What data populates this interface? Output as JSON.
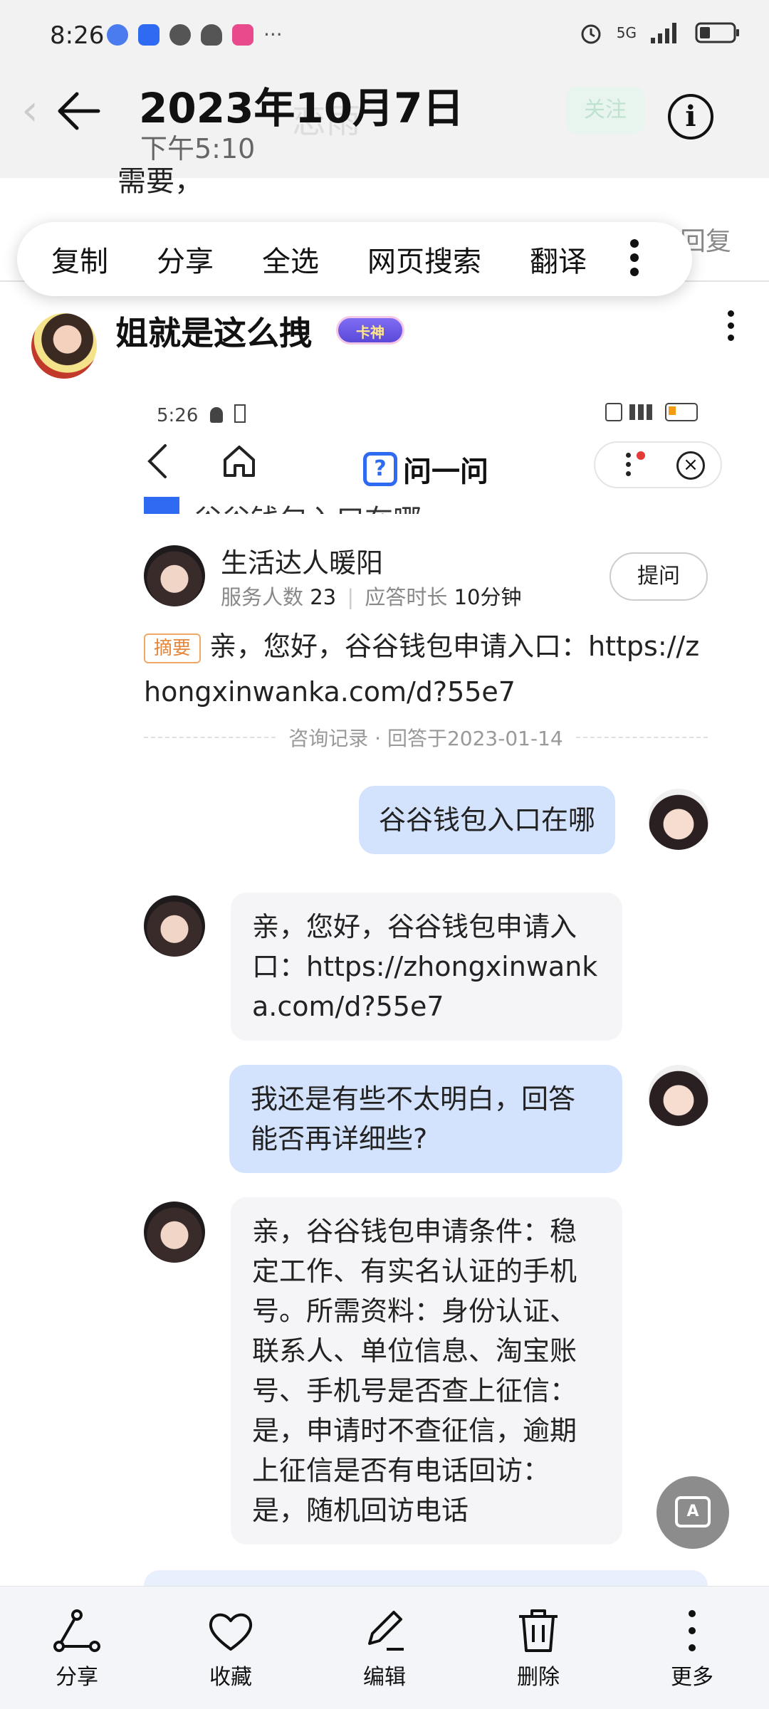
{
  "status_bar": {
    "time": "8:26",
    "more": "···",
    "network": "5G"
  },
  "header": {
    "date": "2023年10月7日",
    "time": "下午5:10",
    "ghost_name": "恋雨",
    "ghost_follow": "关注",
    "info_icon": "info-icon"
  },
  "peek": {
    "text": "需要，",
    "reply": "回复"
  },
  "context_menu": {
    "items": [
      "复制",
      "分享",
      "全选",
      "网页搜索",
      "翻译"
    ]
  },
  "post": {
    "author": "姐就是这么拽",
    "badge": "卡神"
  },
  "embed": {
    "status_time": "5:26",
    "app_title": "问一问",
    "logo_glyph": "?",
    "cut_title": "谷谷钱包入口在哪",
    "expert": {
      "name": "生活达人暖阳",
      "served_label": "服务人数",
      "served": "23",
      "sep": "|",
      "resp_label": "应答时长",
      "resp": "10分钟"
    },
    "ask_button": "提问",
    "summary_tag": "摘要",
    "summary_text": "亲，您好，谷谷钱包申请入口：https://zhongxinwanka.com/d?55e7",
    "record": "咨询记录 · 回答于2023-01-14",
    "messages": [
      {
        "role": "user",
        "text": "谷谷钱包入口在哪"
      },
      {
        "role": "expert",
        "text": "亲，您好，谷谷钱包申请入口：https://zhongxinwanka.com/d?55e7"
      },
      {
        "role": "user",
        "text": "我还是有些不太明白，回答能否再详细些?"
      },
      {
        "role": "expert",
        "text": "亲，谷谷钱包申请条件：稳定工作、有实名认证的手机号。所需资料：身份认证、联系人、单位信息、淘宝账号、手机号是否查上征信：是，申请时不查征信，逾期上征信是否有电话回访：是，随机回访电话"
      }
    ]
  },
  "fab": {
    "glyph": "A"
  },
  "bottom_bar": [
    {
      "label": "分享",
      "icon": "share-icon"
    },
    {
      "label": "收藏",
      "icon": "heart-icon"
    },
    {
      "label": "编辑",
      "icon": "edit-icon"
    },
    {
      "label": "删除",
      "icon": "trash-icon"
    },
    {
      "label": "更多",
      "icon": "more-icon"
    }
  ]
}
